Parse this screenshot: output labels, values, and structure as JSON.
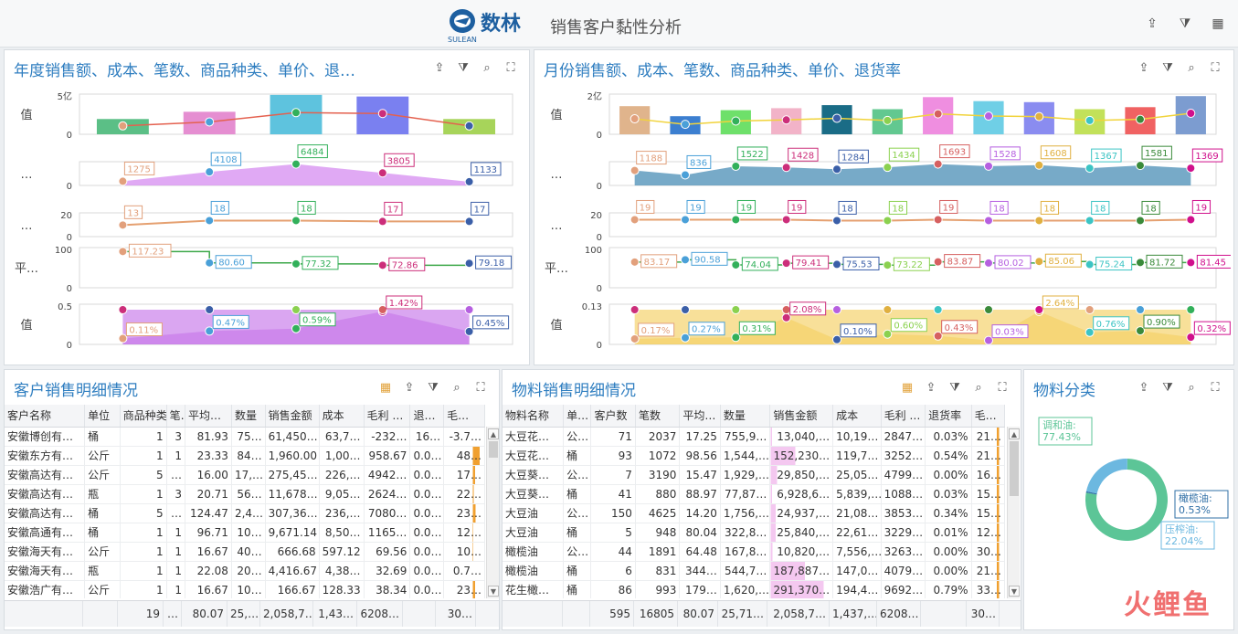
{
  "header": {
    "brand": "数林",
    "brand_sub": "SULEAN",
    "title": "销售客户黏性分析",
    "icons": [
      "export-icon",
      "filter-clear-icon",
      "calendar-icon"
    ]
  },
  "colors": {
    "title": "#2f7ec0"
  },
  "panel_year": {
    "title": "年度销售额、成本、笔数、商品种类、单价、退…",
    "icons": [
      "export-icon",
      "filter-clear-icon",
      "drill-icon",
      "fullscreen-icon"
    ],
    "row_labels": [
      "值",
      "…",
      "…",
      "平…",
      "值"
    ],
    "ticks": [
      [
        "5亿",
        "0"
      ],
      [
        "0"
      ],
      [
        "20",
        "0"
      ],
      [
        "100",
        "0"
      ],
      [
        "0.5",
        "0"
      ]
    ],
    "cost_labels": [
      "1275",
      "4108",
      "6484",
      "3805",
      "1133"
    ],
    "cnt_labels": [
      "13",
      "18",
      "18",
      "17",
      "17"
    ],
    "price_labels": [
      "117.23",
      "80.60",
      "77.32",
      "72.86",
      "79.18"
    ],
    "ret_labels": [
      "0.11%",
      "0.47%",
      "0.59%",
      "1.42%",
      "0.45%"
    ]
  },
  "panel_month": {
    "title": "月份销售额、成本、笔数、商品种类、单价、退货率",
    "icons": [
      "export-icon",
      "filter-clear-icon",
      "drill-icon",
      "fullscreen-icon"
    ],
    "row_labels": [
      "值",
      "…",
      "…",
      "平…",
      "值"
    ],
    "ticks": [
      [
        "2亿",
        "0"
      ],
      [
        "0"
      ],
      [
        "20",
        "0"
      ],
      [
        "100",
        "0"
      ],
      [
        "0.13",
        "0"
      ]
    ],
    "cost_labels": [
      "1188",
      "836",
      "1522",
      "1428",
      "1284",
      "1434",
      "1693",
      "1528",
      "1608",
      "1367",
      "1581",
      "1369"
    ],
    "cnt_labels": [
      "19",
      "19",
      "19",
      "19",
      "18",
      "18",
      "19",
      "18",
      "18",
      "18",
      "18",
      "19"
    ],
    "price_labels": [
      "83.17",
      "90.58",
      "74.04",
      "79.41",
      "75.53",
      "73.22",
      "83.87",
      "80.02",
      "85.06",
      "75.24",
      "81.72",
      "81.45"
    ],
    "ret_labels": [
      "0.17%",
      "0.27%",
      "0.31%",
      "2.08%",
      "0.10%",
      "0.60%",
      "0.43%",
      "0.03%",
      "2.64%",
      "0.76%",
      "0.90%",
      "0.32%"
    ]
  },
  "chart_data": [
    {
      "type": "bar",
      "title": "年度销售额、成本、笔数、商品种类、单价、退…",
      "ylabel": "值",
      "ylim": [
        0,
        5
      ],
      "values": [
        1.9,
        2.8,
        4.9,
        4.7,
        1.9
      ],
      "series": [
        {
          "name": "…",
          "values": [
            1275,
            4108,
            6484,
            3805,
            1133
          ]
        },
        {
          "name": "…",
          "values": [
            13,
            18,
            18,
            17,
            17
          ]
        },
        {
          "name": "平…",
          "values": [
            117.23,
            80.6,
            77.32,
            72.86,
            79.18
          ]
        },
        {
          "name": "值",
          "values": [
            0.11,
            0.47,
            0.59,
            1.42,
            0.45
          ]
        }
      ]
    },
    {
      "type": "bar",
      "title": "月份销售额、成本、笔数、商品种类、单价、退货率",
      "ylabel": "值",
      "ylim": [
        0,
        2
      ],
      "values": [
        1.4,
        0.9,
        1.2,
        1.3,
        1.45,
        1.25,
        1.85,
        1.65,
        1.6,
        1.25,
        1.35,
        1.9
      ],
      "series": [
        {
          "name": "…",
          "values": [
            1188,
            836,
            1522,
            1428,
            1284,
            1434,
            1693,
            1528,
            1608,
            1367,
            1581,
            1369
          ]
        },
        {
          "name": "…",
          "values": [
            19,
            19,
            19,
            19,
            18,
            18,
            19,
            18,
            18,
            18,
            18,
            19
          ]
        },
        {
          "name": "平…",
          "values": [
            83.17,
            90.58,
            74.04,
            79.41,
            75.53,
            73.22,
            83.87,
            80.02,
            85.06,
            75.24,
            81.72,
            81.45
          ]
        },
        {
          "name": "值",
          "values": [
            0.17,
            0.27,
            0.31,
            2.08,
            0.1,
            0.6,
            0.43,
            0.03,
            2.64,
            0.76,
            0.9,
            0.32
          ]
        }
      ]
    },
    {
      "type": "pie",
      "title": "物料分类",
      "categories": [
        "调和油",
        "橄榄油",
        "压榨油"
      ],
      "values": [
        77.43,
        0.53,
        22.04
      ]
    }
  ],
  "customer": {
    "title": "客户销售明细情况",
    "icons": [
      "grid-icon",
      "export-icon",
      "filter-clear-icon",
      "drill-icon",
      "fullscreen-icon"
    ],
    "headers": [
      "客户名称",
      "单位",
      "商品种类",
      "笔…",
      "平均…",
      "数量",
      "销售金额",
      "成本",
      "毛利 …",
      "退…",
      "毛…"
    ],
    "rows": [
      [
        "安徽博创有…",
        "桶",
        "1",
        "3",
        "81.93",
        "75…",
        "61,450…",
        "63,7…",
        "-232…",
        "16…",
        "-3.7…"
      ],
      [
        "安徽东方有…",
        "公斤",
        "1",
        "1",
        "23.33",
        "84…",
        "1,960.00",
        "1,00…",
        "958.67",
        "0.0…",
        "48…"
      ],
      [
        "安徽高达有…",
        "公斤",
        "5",
        "…",
        "16.00",
        "17,…",
        "275,45…",
        "226,…",
        "4942…",
        "0.0…",
        "17…"
      ],
      [
        "安徽高达有…",
        "瓶",
        "1",
        "3",
        "20.71",
        "56…",
        "11,678…",
        "9,05…",
        "2624…",
        "0.0…",
        "22…"
      ],
      [
        "安徽高达有…",
        "桶",
        "5",
        "…",
        "124.47",
        "2,4…",
        "307,36…",
        "236,…",
        "7080…",
        "0.0…",
        "23…"
      ],
      [
        "安徽高通有…",
        "桶",
        "1",
        "1",
        "96.71",
        "10…",
        "9,671.14",
        "8,50…",
        "1165…",
        "0.0…",
        "12…"
      ],
      [
        "安徽海天有…",
        "公斤",
        "1",
        "1",
        "16.67",
        "40…",
        "666.68",
        "597.12",
        "69.56",
        "0.0…",
        "10…"
      ],
      [
        "安徽海天有…",
        "瓶",
        "1",
        "1",
        "22.08",
        "20…",
        "4,416.67",
        "4,38…",
        "32.69",
        "0.0…",
        "0.7…"
      ],
      [
        "安徽浩广有…",
        "公斤",
        "1",
        "1",
        "16.67",
        "10…",
        "166.67",
        "128.33",
        "38.34",
        "0.0…",
        "23…"
      ]
    ],
    "footer": [
      "",
      "",
      "19",
      "…",
      "80.07",
      "25,…",
      "2,058,7…",
      "1,43…",
      "6208…",
      "",
      "30…"
    ],
    "bars": [
      0,
      0.6,
      0.2,
      0.1,
      0.25,
      0.05,
      0.05,
      0,
      0.2
    ]
  },
  "material": {
    "title": "物料销售明细情况",
    "icons": [
      "grid-icon",
      "export-icon",
      "filter-clear-icon",
      "drill-icon",
      "fullscreen-icon"
    ],
    "headers": [
      "物料名称",
      "单…",
      "客户数",
      "笔数",
      "平均…",
      "数量",
      "销售金额",
      "成本",
      "毛利 …",
      "退货率",
      "毛…"
    ],
    "rows": [
      [
        "大豆花…",
        "公…",
        "71",
        "2037",
        "17.25",
        "755,9…",
        "13,040,…",
        "10,19…",
        "2847…",
        "0.03%",
        "21…"
      ],
      [
        "大豆花…",
        "桶",
        "93",
        "1072",
        "98.56",
        "1,544,…",
        "152,230…",
        "119,7…",
        "3252…",
        "0.54%",
        "21…"
      ],
      [
        "大豆葵…",
        "公…",
        "7",
        "3190",
        "15.47",
        "1,929,…",
        "29,850,…",
        "25,05…",
        "4799…",
        "0.00%",
        "16…"
      ],
      [
        "大豆葵…",
        "桶",
        "41",
        "880",
        "88.97",
        "77,87…",
        "6,928,6…",
        "5,839,…",
        "1088…",
        "0.03%",
        "15…"
      ],
      [
        "大豆油",
        "公…",
        "150",
        "4625",
        "14.20",
        "1,756,…",
        "24,937,…",
        "21,08…",
        "3853…",
        "0.34%",
        "15…"
      ],
      [
        "大豆油",
        "桶",
        "5",
        "948",
        "80.04",
        "322,8…",
        "25,840,…",
        "22,61…",
        "3229…",
        "0.01%",
        "12…"
      ],
      [
        "橄榄油",
        "公…",
        "44",
        "1891",
        "64.48",
        "167,8…",
        "10,820,…",
        "7,556,…",
        "3263…",
        "0.00%",
        "30…"
      ],
      [
        "橄榄油",
        "桶",
        "6",
        "831",
        "344…",
        "544,7…",
        "187,887…",
        "147,0…",
        "4079…",
        "0.00%",
        "21…"
      ],
      [
        "花生橄…",
        "桶",
        "86",
        "993",
        "179…",
        "1,620,…",
        "291,370…",
        "194,4…",
        "9692…",
        "0.79%",
        "33…"
      ]
    ],
    "footer": [
      "",
      "",
      "595",
      "16805",
      "80.07",
      "25,71…",
      "2,058,7…",
      "1,437,…",
      "6208…",
      "",
      "30…"
    ],
    "sales_fill": [
      0.02,
      0.4,
      0.1,
      0.02,
      0.08,
      0.08,
      0.03,
      0.55,
      0.85
    ]
  },
  "pie": {
    "title": "物料分类",
    "icons": [
      "export-icon",
      "filter-clear-icon",
      "drill-icon",
      "fullscreen-icon"
    ],
    "labels": [
      {
        "name": "调和油:",
        "pct": "77.43%"
      },
      {
        "name": "橄榄油:",
        "pct": "0.53%"
      },
      {
        "name": "压榨油:",
        "pct": "22.04%"
      }
    ],
    "colors": [
      "#5cc597",
      "#2f6fa6",
      "#6cb8e0"
    ]
  },
  "watermark": "火鲤鱼"
}
